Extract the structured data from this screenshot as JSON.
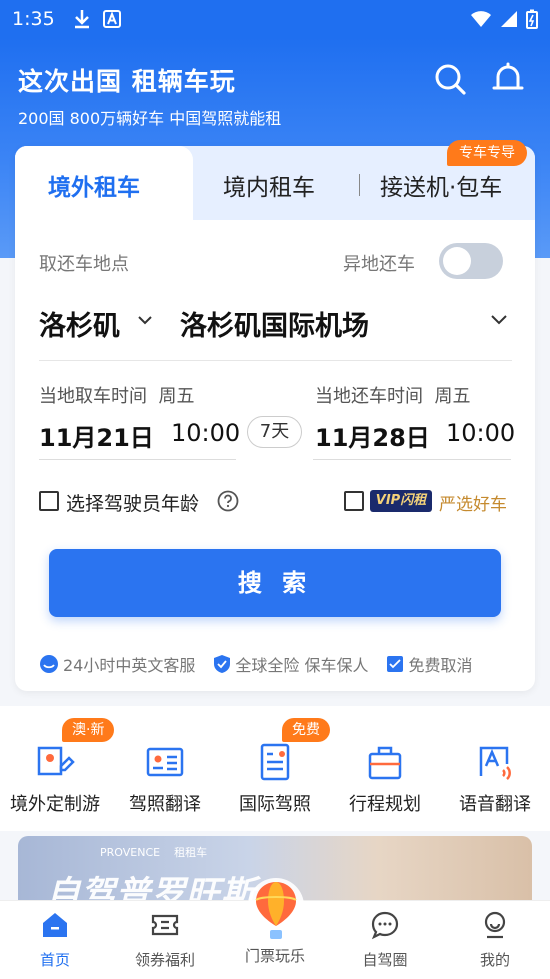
{
  "status_bar": {
    "time": "1:35"
  },
  "header": {
    "title": "这次出国 租辆车玩",
    "subtitle": "200国 800万辆好车 中国驾照就能租"
  },
  "tabs": {
    "active": "境外租车",
    "second": "境内租车",
    "third": "接送机·包车",
    "badge": "专车专导"
  },
  "form": {
    "pickup_label": "取还车地点",
    "diff_return_label": "异地还车",
    "diff_return_on": false,
    "city": "洛杉矶",
    "location": "洛杉矶国际机场",
    "pickup_time_label": "当地取车时间",
    "pickup_weekday": "周五",
    "pickup_date": "11月21日",
    "pickup_time": "10:00",
    "duration": "7天",
    "return_time_label": "当地还车时间",
    "return_weekday": "周五",
    "return_date": "11月28日",
    "return_time": "10:00",
    "driver_age_label": "选择驾驶员年龄",
    "vip_badge": "VIP闪租",
    "vip_label": "严选好车",
    "search_label": "搜 索"
  },
  "guarantees": [
    "24小时中英文客服",
    "全球全险 保车保人",
    "免费取消"
  ],
  "quick_nav": [
    {
      "label": "境外定制游",
      "badge": "澳·新",
      "icon": "map-pin-pen-icon"
    },
    {
      "label": "驾照翻译",
      "badge": "",
      "icon": "id-card-icon"
    },
    {
      "label": "国际驾照",
      "badge": "免费",
      "icon": "license-document-icon"
    },
    {
      "label": "行程规划",
      "badge": "",
      "icon": "suitcase-icon"
    },
    {
      "label": "语音翻译",
      "badge": "",
      "icon": "voice-translate-icon"
    }
  ],
  "banner": {
    "logo_left": "PROVENCE",
    "logo_right": "租租车",
    "title": "自驾普罗旺斯"
  },
  "bottom_nav": [
    {
      "label": "首页",
      "active": true,
      "icon": "home-icon"
    },
    {
      "label": "领券福利",
      "active": false,
      "icon": "coupon-icon"
    },
    {
      "label": "门票玩乐",
      "active": false,
      "icon": "balloon-icon"
    },
    {
      "label": "自驾圈",
      "active": false,
      "icon": "chat-icon"
    },
    {
      "label": "我的",
      "active": false,
      "icon": "profile-icon"
    }
  ],
  "colors": {
    "primary": "#1f6ff0",
    "accent": "#ff7a1a",
    "vip_gold": "#c58a2e"
  }
}
